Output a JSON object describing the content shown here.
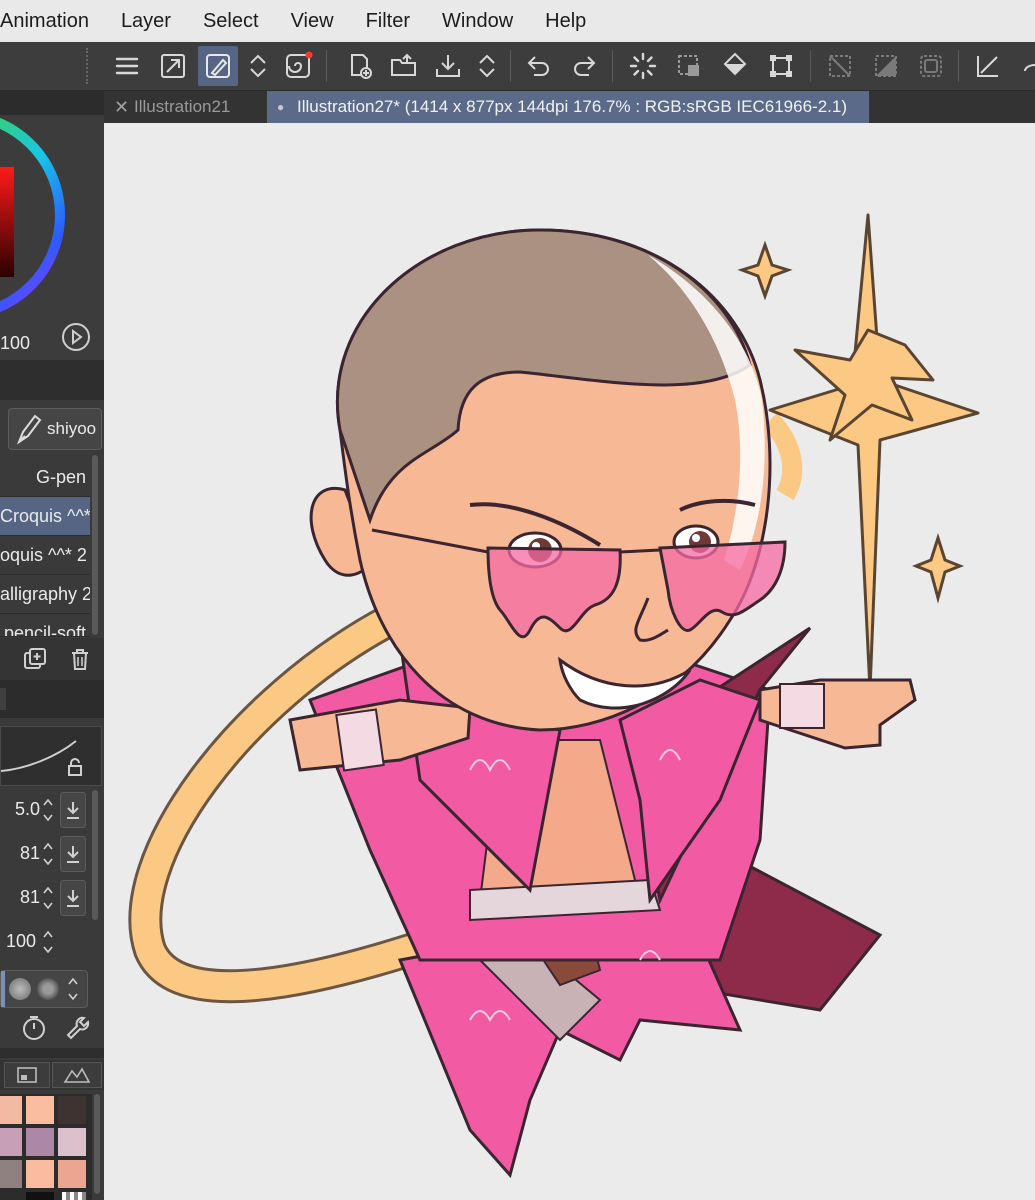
{
  "menubar": {
    "items": [
      "Animation",
      "Layer",
      "Select",
      "View",
      "Filter",
      "Window",
      "Help"
    ]
  },
  "toolbar": {
    "icons": [
      "menu-icon",
      "fit-canvas-icon",
      "brush-tool-icon",
      "up-down-arrows-icon",
      "spiral-icon",
      "new-canvas-icon",
      "open-folder-icon",
      "save-icon",
      "up-down-arrows-icon",
      "undo-icon",
      "redo-icon",
      "loading-spinner-icon",
      "clear-selection-icon",
      "fill-bucket-icon",
      "transform-icon",
      "deselect-icon",
      "invert-selection-icon",
      "selection-border-icon",
      "ruler-icon"
    ]
  },
  "color_panel": {
    "opacity_value": "100"
  },
  "brush_panel": {
    "tool_tab_label": "shiyoo",
    "brushes": [
      {
        "label": "G-pen",
        "selected": false
      },
      {
        "label": "Croquis ^^*",
        "selected": true
      },
      {
        "label": "oquis ^^* 2",
        "selected": false
      },
      {
        "label": "alligraphy 2",
        "selected": false
      },
      {
        "label": "pencil-soft",
        "selected": false
      }
    ]
  },
  "tool_property": {
    "values": [
      "5.0",
      "81",
      "81",
      "100"
    ]
  },
  "color_set": {
    "swatches": [
      "#f4b9a3",
      "#fbbd9f",
      "#3e3331",
      "#c7a0b6",
      "#ad87a6",
      "#dcc0cc",
      "#8e8180",
      "#fabb9e",
      "#eca591"
    ]
  },
  "tabs": [
    {
      "label": "Illustration21",
      "active": false
    },
    {
      "label": "Illustration27* (1414 x 877px 144dpi 176.7% : RGB:sRGB IEC61966-2.1)",
      "active": true
    }
  ],
  "colors": {
    "menubar_bg": "#e9e9e9",
    "toolbar_bg": "#3d3d3d",
    "active_accent": "#566584",
    "canvas_bg": "#ebebeb",
    "coat_pink": "#f25aa3",
    "skin": "#f7b895",
    "gold": "#fcc985"
  }
}
